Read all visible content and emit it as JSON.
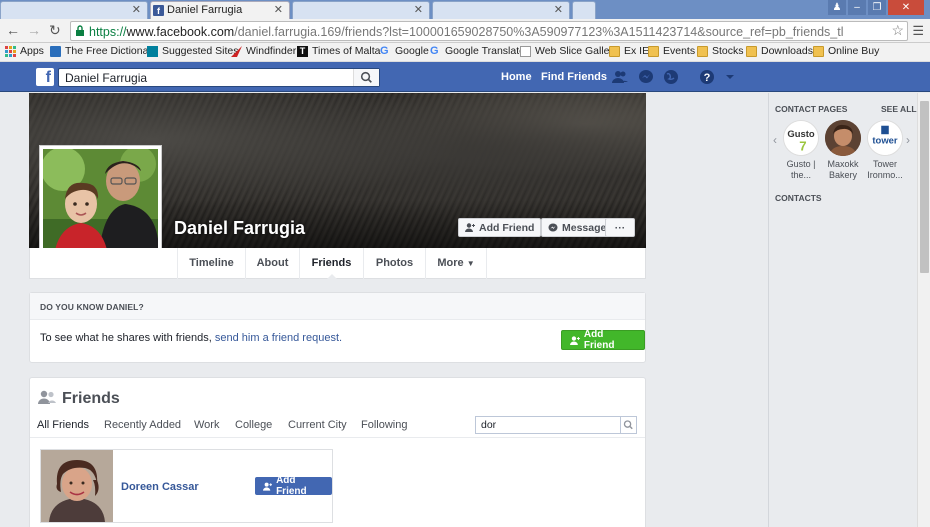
{
  "browser": {
    "tabs": [
      {
        "title": "",
        "active": false
      },
      {
        "title": "Daniel Farrugia",
        "active": true
      },
      {
        "title": "",
        "active": false
      },
      {
        "title": "",
        "active": false
      }
    ],
    "url_protocol": "https://",
    "url_host": "www.facebook.com",
    "url_rest": "/daniel.farrugia.169/friends?lst=100001659028750%3A590977123%3A1511423714&source_ref=pb_friends_tl",
    "bookmarks": [
      {
        "label": "Apps",
        "icon": "apps-grid-icon"
      },
      {
        "label": "The Free Dictionary",
        "icon": "dictionary-icon"
      },
      {
        "label": "Suggested Sites",
        "icon": "bing-icon"
      },
      {
        "label": "Windfinder",
        "icon": "windfinder-icon"
      },
      {
        "label": "Times of Malta",
        "icon": "times-icon"
      },
      {
        "label": "Google",
        "icon": "google-icon"
      },
      {
        "label": "Google Translate",
        "icon": "google-icon"
      },
      {
        "label": "Web Slice Gallery",
        "icon": "page-icon"
      },
      {
        "label": "Ex IE",
        "icon": "folder-icon"
      },
      {
        "label": "Events",
        "icon": "folder-icon"
      },
      {
        "label": "Stocks",
        "icon": "folder-icon"
      },
      {
        "label": "Downloads",
        "icon": "folder-icon"
      },
      {
        "label": "Online Buy",
        "icon": "folder-icon"
      }
    ]
  },
  "fb": {
    "search_value": "Daniel Farrugia",
    "nav_home": "Home",
    "nav_find_friends": "Find Friends"
  },
  "profile": {
    "name": "Daniel Farrugia",
    "add_friend": "Add Friend",
    "message": "Message",
    "more_dots": "···",
    "tabs": [
      "Timeline",
      "About",
      "Friends",
      "Photos",
      "More"
    ],
    "active_tab": "Friends"
  },
  "dyk": {
    "heading": "DO YOU KNOW DANIEL?",
    "text": "To see what he shares with friends,",
    "link": "send him a friend request.",
    "button": "Add Friend"
  },
  "friends": {
    "title": "Friends",
    "tabs": [
      "All Friends",
      "Recently Added",
      "Work",
      "College",
      "Current City",
      "Following"
    ],
    "search_value": "dor",
    "results": [
      {
        "name": "Doreen Cassar",
        "button": "Add Friend"
      }
    ]
  },
  "sidebar": {
    "contact_pages_heading": "CONTACT PAGES",
    "see_all": "SEE ALL",
    "pages": [
      {
        "label_line1": "Gusto |",
        "label_line2": "the...",
        "logo_text": "Gusto"
      },
      {
        "label_line1": "Maxokk",
        "label_line2": "Bakery",
        "logo_text": ""
      },
      {
        "label_line1": "Tower",
        "label_line2": "Ironmo...",
        "logo_text": "tower"
      }
    ],
    "contacts_heading": "CONTACTS"
  },
  "colors": {
    "fb_blue": "#4267b2",
    "green_button": "#42b72a",
    "link_blue": "#365899"
  }
}
